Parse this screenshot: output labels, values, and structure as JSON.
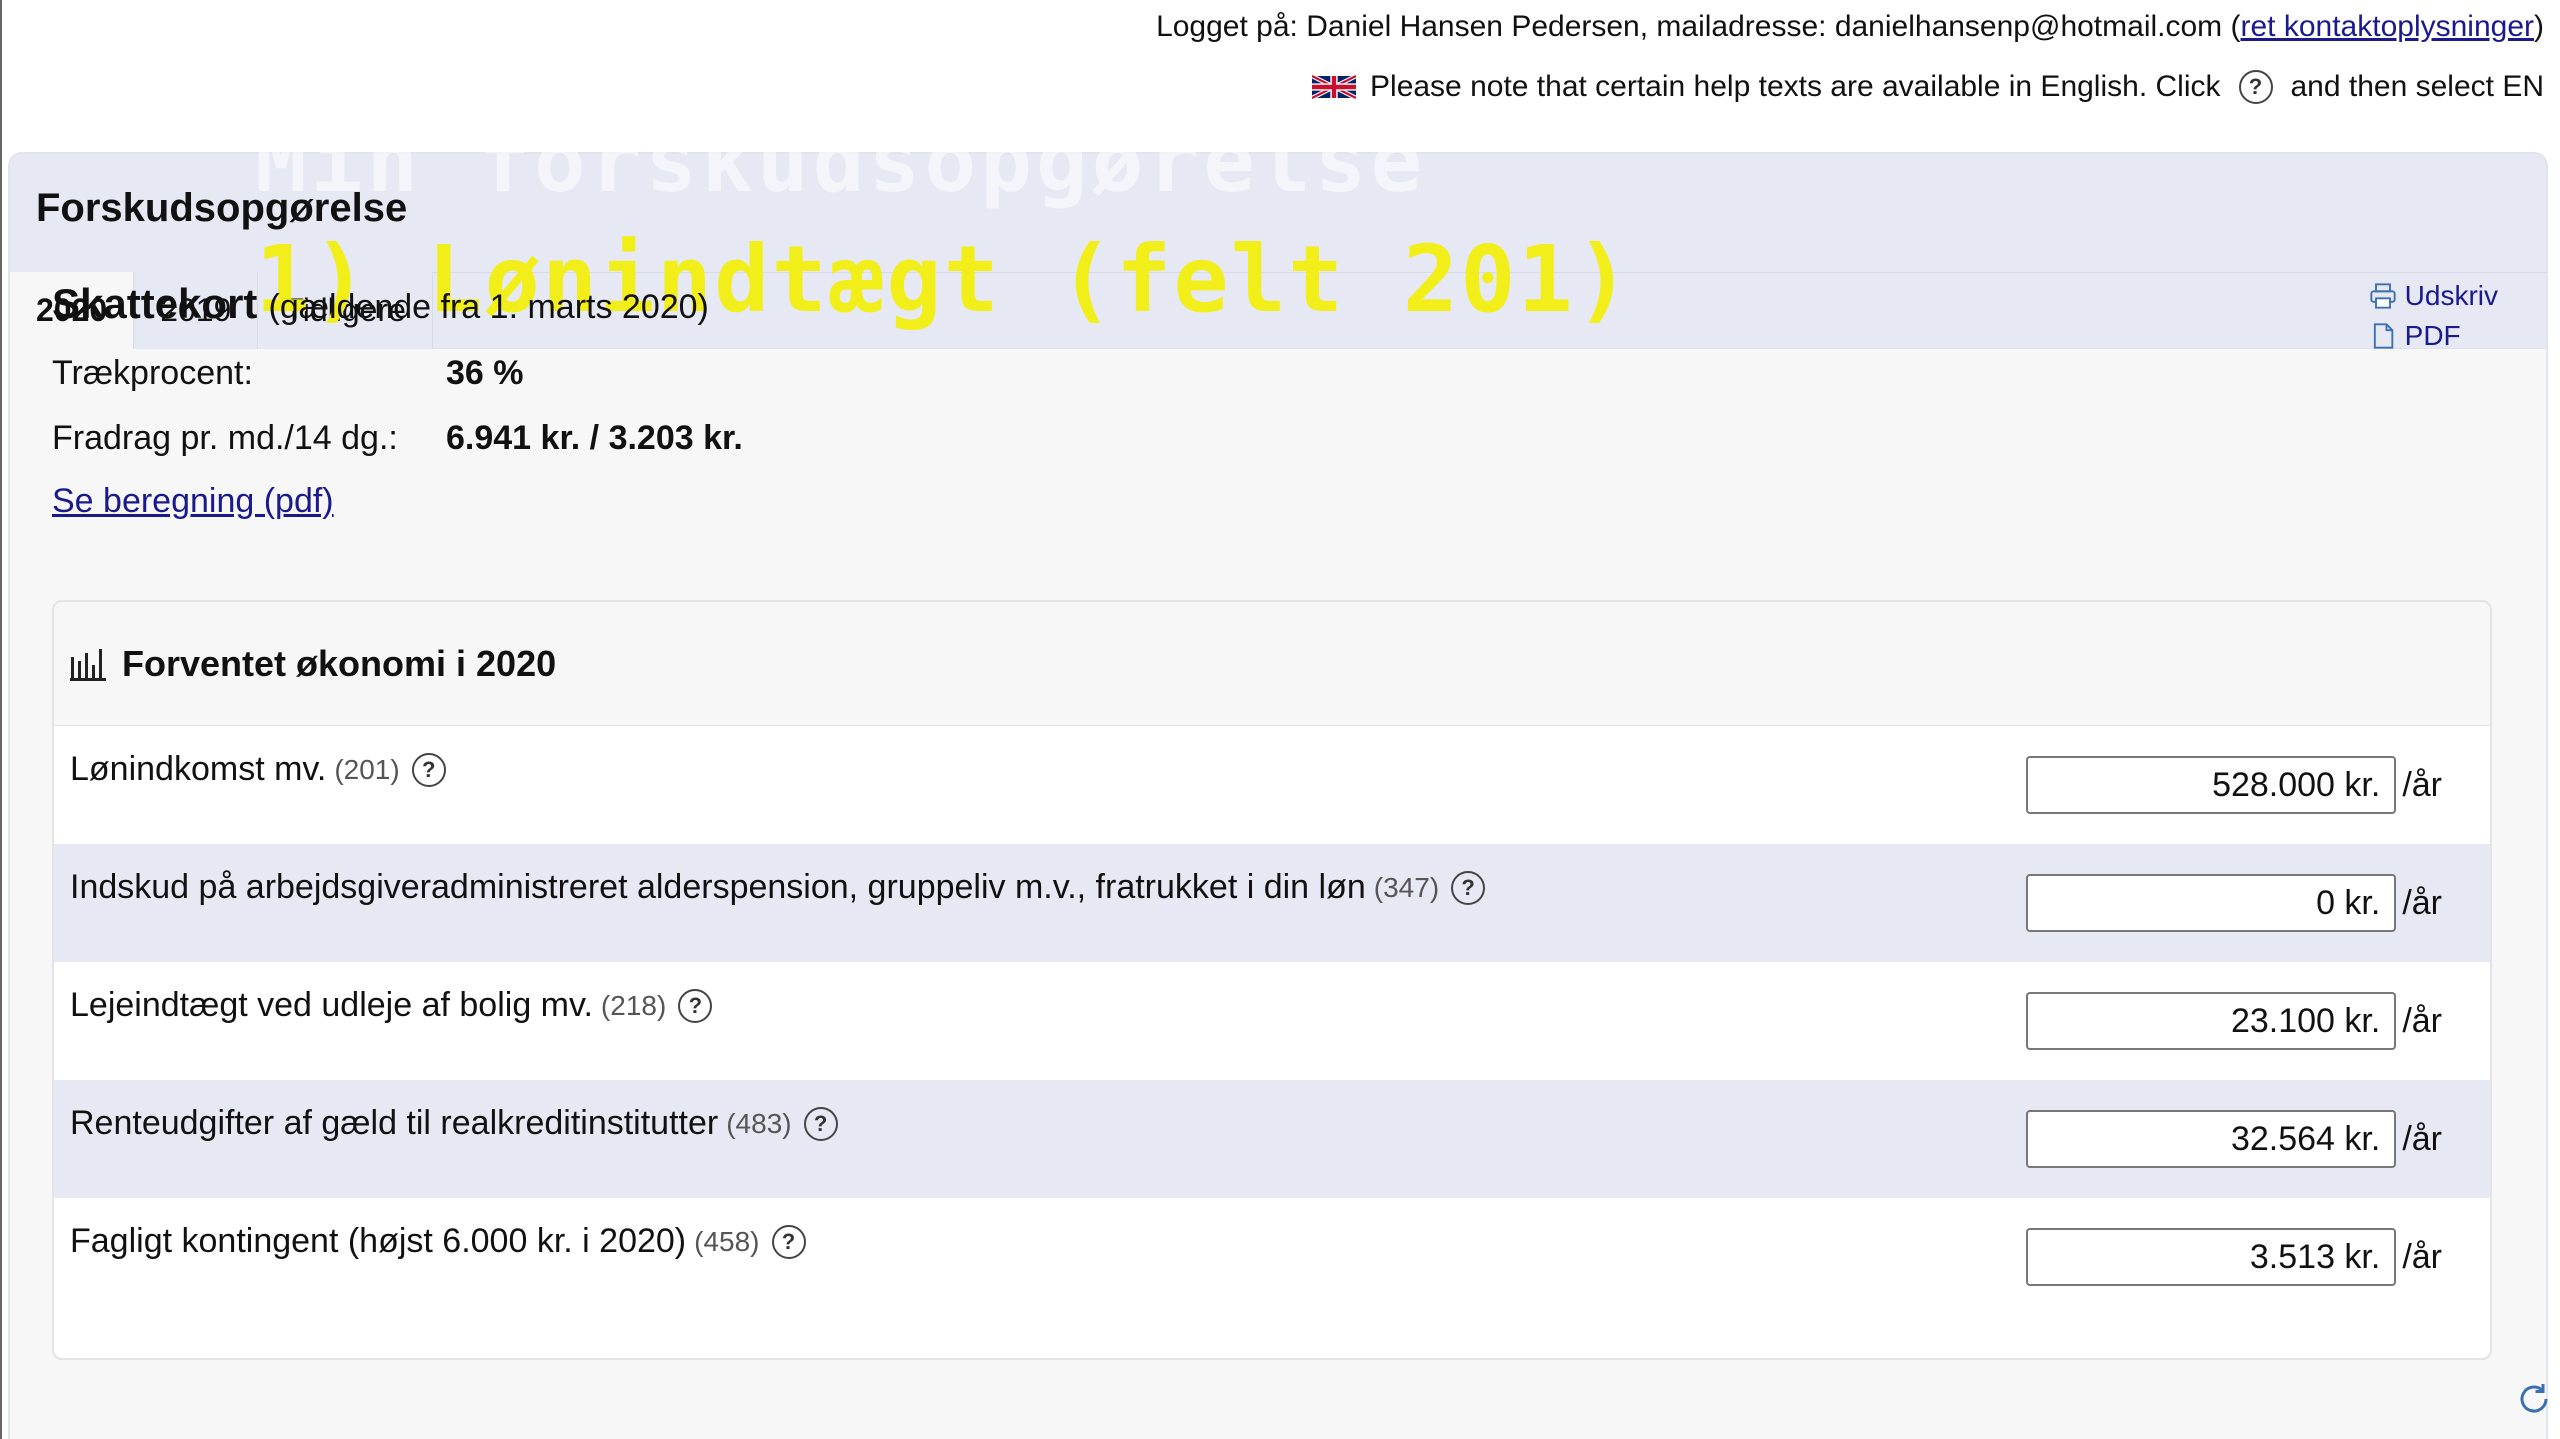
{
  "header": {
    "logged_in_prefix": "Logget på: Daniel Hansen Pedersen, mailadresse: danielhansenp@hotmail.com (",
    "edit_contact_link": "ret kontaktoplysninger",
    "logged_in_suffix": ")",
    "notice_before": "Please note that certain help texts are available in English. Click",
    "notice_after": "and then select EN",
    "help_glyph": "?"
  },
  "panel": {
    "title": "Forskudsopgørelse",
    "tabs": [
      "2020",
      "2019",
      "Tidligere"
    ],
    "active_tab": "2020"
  },
  "video_overlay": {
    "heading": "Min forskudsopgørelse",
    "caption": "1) Lønindtægt (felt 201)",
    "caption_color": "#f2ee1a"
  },
  "skattekort": {
    "title": "Skattekort",
    "subtitle": "(gældende fra 1. marts 2020)",
    "rows": [
      {
        "label": "Trækprocent:",
        "value": "36 %"
      },
      {
        "label": "Fradrag pr. md./14 dg.:",
        "value": "6.941 kr. / 3.203 kr."
      }
    ],
    "link": "Se beregning (pdf)"
  },
  "actions": {
    "print": "Udskriv",
    "pdf": "PDF",
    "print_icon": "printer-icon",
    "pdf_icon": "document-icon"
  },
  "economy": {
    "title": "Forventet økonomi i 2020",
    "icon": "bar-chart-icon",
    "unit": "/år",
    "rows": [
      {
        "label": "Lønindkomst mv.",
        "code": "(201)",
        "value": "528.000 kr."
      },
      {
        "label": "Indskud på arbejdsgiveradministreret alderspension, gruppeliv m.v., fratrukket i din løn",
        "code": "(347)",
        "value": "0 kr."
      },
      {
        "label": "Lejeindtægt ved udleje af bolig mv.",
        "code": "(218)",
        "value": "23.100 kr."
      },
      {
        "label": "Renteudgifter af gæld til realkreditinstitutter",
        "code": "(483)",
        "value": "32.564 kr."
      },
      {
        "label": "Fagligt kontingent (højst 6.000 kr. i 2020)",
        "code": "(458)",
        "value": "3.513 kr."
      }
    ]
  },
  "colors": {
    "link": "#1a1a8c",
    "header_band": "#e6e9f4",
    "alt_row": "#e6e9f4"
  }
}
